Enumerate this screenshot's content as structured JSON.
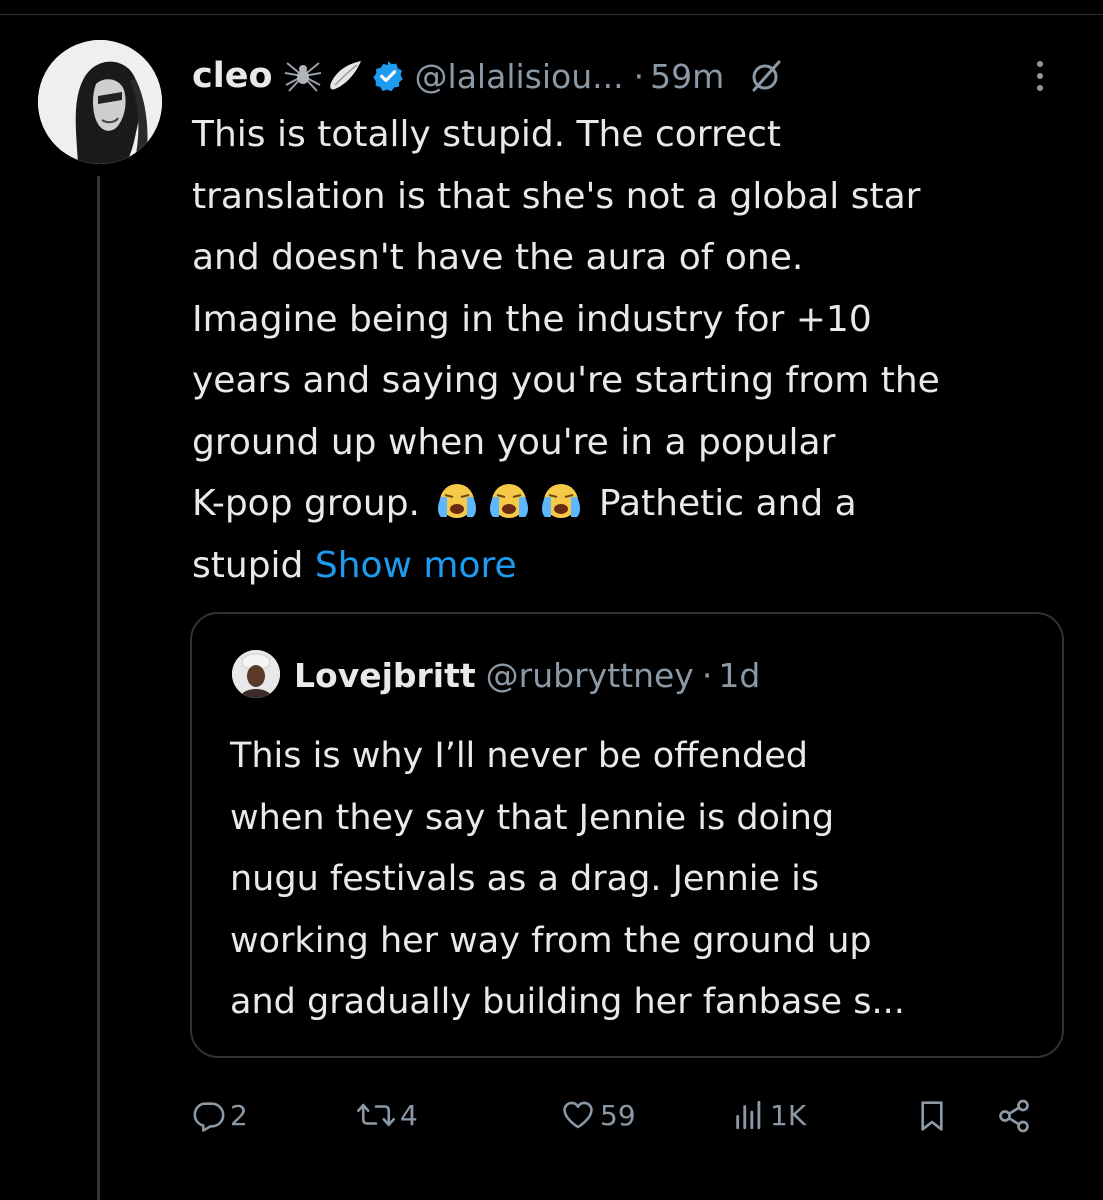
{
  "tweet": {
    "display_name": "cleo",
    "handle": "@lalalisiou...",
    "separator": "·",
    "time": "59m",
    "body_lines": [
      "This is totally stupid. The correct",
      "translation is that she's not a global star",
      "and doesn't have the aura of one.",
      "Imagine being in the industry for +10",
      "years and saying you're starting from the",
      "ground up when you're in a popular"
    ],
    "line7_start": "K-pop group. ",
    "line7_end": " Pathetic and a",
    "line8_start": "stupid ",
    "show_more": "Show more",
    "icons": [
      "spider-emoji",
      "wing-emoji",
      "verified-badge-icon",
      "grok-icon",
      "more-options-icon",
      "crying-face-emoji"
    ]
  },
  "quote": {
    "display_name": "Lovejbritt",
    "handle": "@rubryttney",
    "separator": "·",
    "time": "1d",
    "body_lines": [
      "This is why I’ll never be offended",
      "when they say that Jennie is doing",
      "nugu festivals as a drag. Jennie is",
      "working her way from the ground up",
      "and gradually building her fanbase s..."
    ]
  },
  "actions": {
    "replies": "2",
    "reposts": "4",
    "likes": "59",
    "views": "1K"
  },
  "colors": {
    "background": "#000000",
    "text": "#e7e9ea",
    "muted": "#8b98a5",
    "link": "#1d9bf0",
    "border": "#2f3336"
  }
}
